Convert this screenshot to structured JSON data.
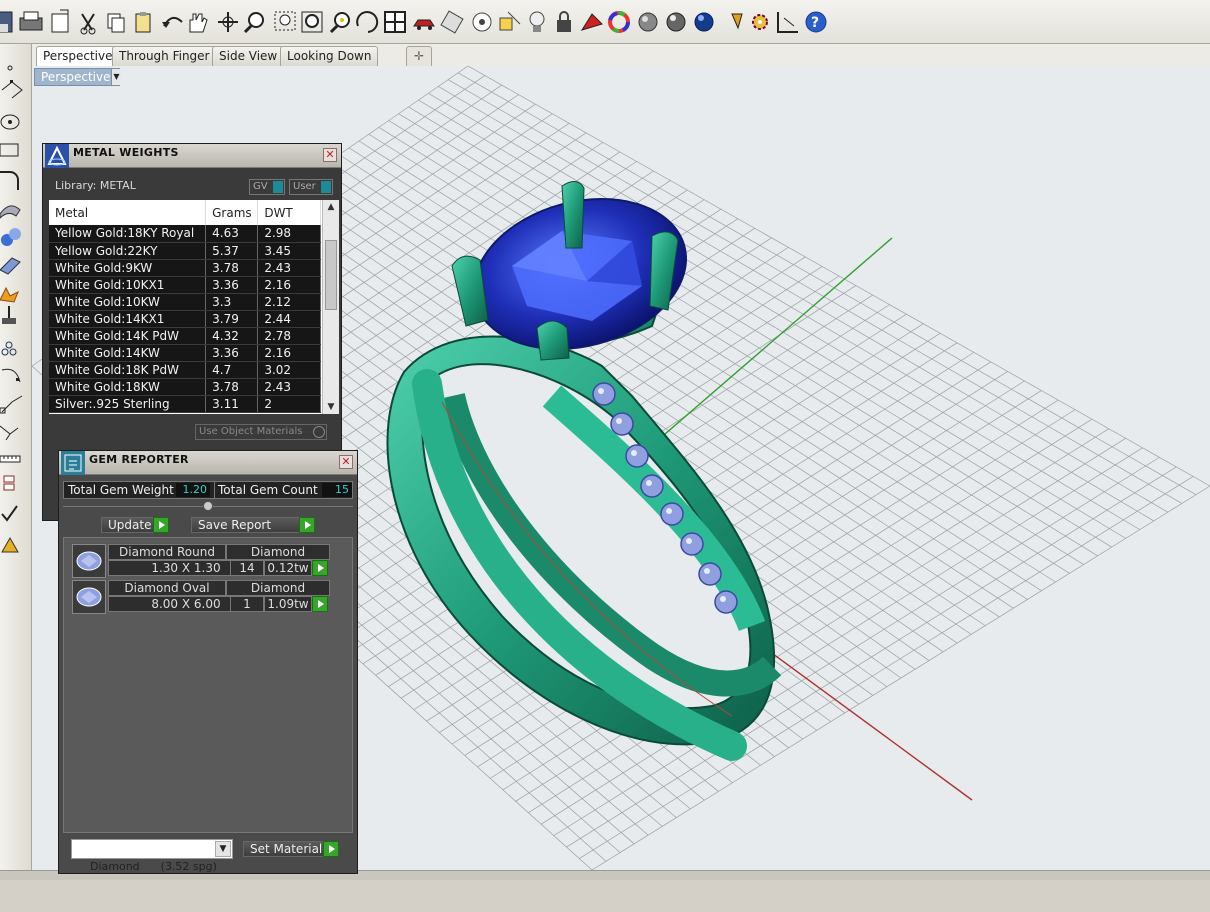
{
  "toolbar": {
    "icons": [
      "save-icon",
      "print-icon",
      "new-layer-icon",
      "cut-icon",
      "copy-icon",
      "paste-icon",
      "undo-icon",
      "pan-hand-icon",
      "move-icon",
      "zoom-icon",
      "zoom-window-icon",
      "zoom-extents-icon",
      "zoom-selected-icon",
      "rotate-view-icon",
      "four-viewports-icon",
      "car-icon",
      "object-properties-icon",
      "target-icon",
      "layer-tool-icon",
      "light-bulb-icon",
      "lock-icon",
      "render-icon",
      "color-wheel-icon",
      "shaded-sphere-icon",
      "rendered-sphere-icon",
      "blue-sphere-icon",
      "flag-icon",
      "gears-icon",
      "snap-icon",
      "help-icon"
    ]
  },
  "tabs": [
    "Perspective",
    "Through Finger",
    "Side View",
    "Looking Down"
  ],
  "viewport": {
    "label": "Perspective"
  },
  "metal_weights": {
    "title": "METAL WEIGHTS",
    "library_label": "Library: METAL",
    "gv_label": "GV",
    "user_label": "User",
    "columns": [
      "Metal",
      "Grams",
      "DWT"
    ],
    "rows": [
      {
        "metal": "Yellow Gold:18KY Royal",
        "grams": "4.63",
        "dwt": "2.98"
      },
      {
        "metal": "Yellow Gold:22KY",
        "grams": "5.37",
        "dwt": "3.45"
      },
      {
        "metal": "White Gold:9KW",
        "grams": "3.78",
        "dwt": "2.43"
      },
      {
        "metal": "White Gold:10KX1",
        "grams": "3.36",
        "dwt": "2.16"
      },
      {
        "metal": "White Gold:10KW",
        "grams": "3.3",
        "dwt": "2.12"
      },
      {
        "metal": "White Gold:14KX1",
        "grams": "3.79",
        "dwt": "2.44"
      },
      {
        "metal": "White Gold:14K PdW",
        "grams": "4.32",
        "dwt": "2.78"
      },
      {
        "metal": "White Gold:14KW",
        "grams": "3.36",
        "dwt": "2.16"
      },
      {
        "metal": "White Gold:18K PdW",
        "grams": "4.7",
        "dwt": "3.02"
      },
      {
        "metal": "White Gold:18KW",
        "grams": "3.78",
        "dwt": "2.43"
      },
      {
        "metal": "Silver:.925 Sterling",
        "grams": "3.11",
        "dwt": "2"
      }
    ],
    "use_object_materials": "Use Object Materials"
  },
  "gem_reporter": {
    "title": "GEM REPORTER",
    "total_weight_label": "Total Gem Weight",
    "total_weight_value": "1.20",
    "total_count_label": "Total Gem Count",
    "total_count_value": "15",
    "update_label": "Update",
    "save_report_label": "Save Report",
    "gems": [
      {
        "shape": "Diamond Round",
        "material": "Diamond",
        "size": "1.30 X 1.30",
        "count": "14",
        "weight": "0.12tw"
      },
      {
        "shape": "Diamond Oval",
        "material": "Diamond",
        "size": "8.00 X 6.00",
        "count": "1",
        "weight": "1.09tw"
      }
    ],
    "material_select": "Diamond      (3.52 spg)",
    "set_material_label": "Set Material"
  },
  "colors": {
    "ring_metal": "#1e9a78",
    "center_stone": "#1f2fb8",
    "side_stones": "#8f9fe0",
    "grid_line": "#9aa0a4",
    "x_axis": "#b03030",
    "y_axis": "#30a030"
  }
}
